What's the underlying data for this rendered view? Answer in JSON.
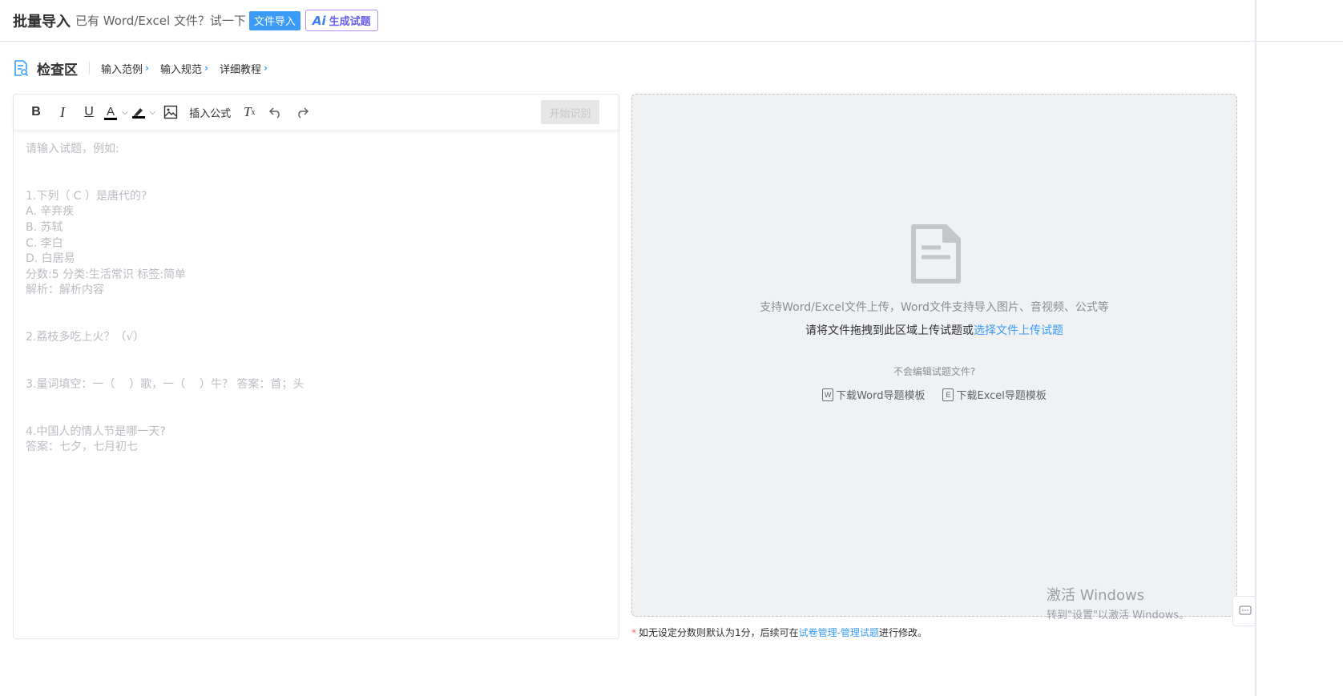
{
  "header": {
    "title": "批量导入",
    "subtitle": "已有 Word/Excel 文件？试一下",
    "import_button": "文件导入",
    "ai_button_mark": "Ai",
    "ai_button_label": "生成试题"
  },
  "checkbar": {
    "title": "检查区",
    "links": [
      "输入范例",
      "输入规范",
      "详细教程"
    ]
  },
  "toolbar": {
    "bold": "B",
    "italic": "I",
    "underline": "U",
    "font_color": "A",
    "insert_formula": "插入公式",
    "clear_format": "T",
    "clear_format_sub": "x",
    "start_button": "开始识别"
  },
  "editor": {
    "placeholder_lines": [
      "请输入试题，例如:",
      "",
      "",
      "1.下列（ C ）是唐代的?",
      "A. 辛弃疾",
      "B. 苏轼",
      "C. 李白",
      "D. 白居易",
      "分数:5 分类:生活常识 标签:简单",
      "解析：解析内容",
      "",
      "",
      "2.荔枝多吃上火？（√）",
      "",
      "",
      "3.量词填空：一（    ）歌，一（    ）牛？ 答案：首；头",
      "",
      "",
      "4.中国人的情人节是哪一天?",
      "答案：七夕，七月初七"
    ]
  },
  "upload": {
    "hint_support": "支持Word/Excel文件上传，Word文件支持导入图片、音视频、公式等",
    "hint_drag_prefix": "请将文件拖拽到此区域上传试题或",
    "hint_choose": "选择文件上传试题",
    "hint_help": "不会编辑试题文件?",
    "word_icon": "W",
    "download_word": "下载Word导题模板",
    "excel_icon": "E",
    "download_excel": "下载Excel导题模板"
  },
  "watermark": {
    "line1": "激活 Windows",
    "line2": "转到\"设置\"以激活 Windows。"
  },
  "footnote": {
    "star": "*",
    "prefix": "如无设定分数则默认为1分，后续可在",
    "link": "试卷管理-管理试题",
    "suffix": "进行修改。"
  },
  "colors": {
    "accent": "#3a9cf7",
    "ai_border": "#b48cf2",
    "placeholder": "#b9bcc1",
    "upload_bg": "#f0f1f3",
    "required_star": "#f56c6c"
  },
  "icons": [
    "doc-check-icon",
    "chevron-right-icon",
    "image-icon",
    "undo-icon",
    "redo-icon",
    "file-icon",
    "word-file-icon",
    "excel-file-icon",
    "chat-icon"
  ]
}
